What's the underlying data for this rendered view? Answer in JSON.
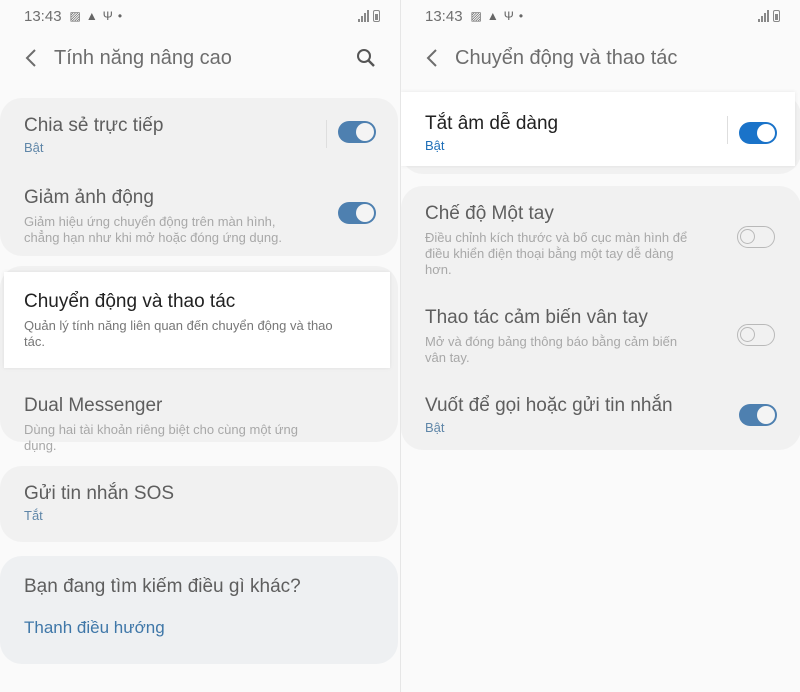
{
  "status_bar": {
    "time": "13:43"
  },
  "left": {
    "header": {
      "title": "Tính năng nâng cao"
    },
    "items": [
      {
        "title": "Chia sẻ trực tiếp",
        "status": "Bật",
        "toggle": "on"
      },
      {
        "title": "Giảm ảnh động",
        "desc_line1": "Giảm hiệu ứng chuyển động trên màn hình,",
        "desc_line2": "chẳng hạn như khi mở hoặc đóng ứng dụng.",
        "toggle": "on"
      },
      {
        "title": "Chuyển động và thao tác",
        "desc_line1": "Quản lý tính năng liên quan đến chuyển động và thao",
        "desc_line2": "tác."
      },
      {
        "title": "Dual Messenger",
        "desc": "Dùng hai tài khoản riêng biệt cho cùng một ứng dụng."
      },
      {
        "title": "Gửi tin nhắn SOS",
        "status": "Tắt"
      }
    ],
    "help": {
      "title": "Bạn đang tìm kiếm điều gì khác?",
      "link": "Thanh điều hướng"
    }
  },
  "right": {
    "header": {
      "title": "Chuyển động và thao tác"
    },
    "items": [
      {
        "title": "Tắt âm dễ dàng",
        "status": "Bật",
        "toggle": "on"
      },
      {
        "title": "Chế độ Một tay",
        "desc_line1": "Điều chỉnh kích thước và bố cục màn hình để",
        "desc_line2": "điều khiển điện thoại bằng một tay dễ dàng",
        "desc_line3": "hơn.",
        "toggle": "off"
      },
      {
        "title": "Thao tác cảm biến vân tay",
        "desc_line1": "Mở và đóng bảng thông báo bằng cảm biến",
        "desc_line2": "vân tay.",
        "toggle": "off"
      },
      {
        "title": "Vuốt để gọi hoặc gửi tin nhắn",
        "status": "Bật",
        "toggle": "on"
      }
    ]
  },
  "colors": {
    "accent": "#1a73c9",
    "dim_accent": "#4e80b0",
    "background": "#fafafa",
    "card": "#f1f1f1"
  }
}
